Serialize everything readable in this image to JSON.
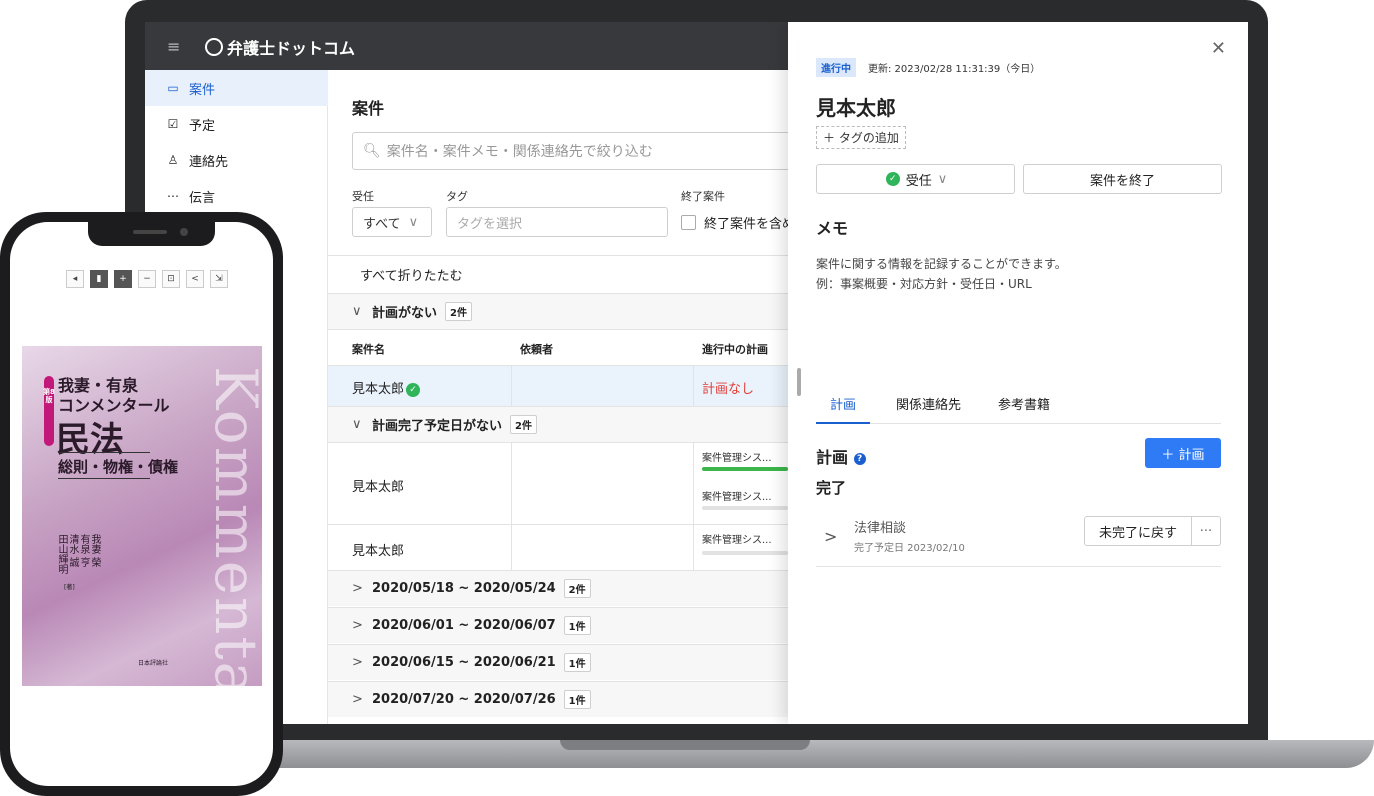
{
  "app": {
    "logo": "弁護士ドットコム",
    "menu_icon": "≡"
  },
  "sidebar": {
    "items": [
      {
        "label": "案件",
        "icon": "folder-icon",
        "glyph": "▭",
        "active": true
      },
      {
        "label": "予定",
        "icon": "checkbox-icon",
        "glyph": "☑",
        "active": false
      },
      {
        "label": "連絡先",
        "icon": "person-icon",
        "glyph": "♙",
        "active": false
      },
      {
        "label": "伝言",
        "icon": "message-icon",
        "glyph": "⋯",
        "active": false
      }
    ]
  },
  "main": {
    "title": "案件",
    "search_placeholder": "案件名・案件メモ・関係連絡先で絞り込む",
    "filters": {
      "assign_label": "受任",
      "assign_value": "すべて",
      "tag_label": "タグ",
      "tag_placeholder": "タグを選択",
      "closed_label": "終了案件",
      "closed_checkbox": "終了案件を含め"
    },
    "collapse_all": "すべて折りたたむ",
    "columns": [
      "案件名",
      "依頼者",
      "進行中の計画"
    ],
    "groups": [
      {
        "title": "計画がない",
        "count": "2件",
        "rows": [
          {
            "name": "見本太郎",
            "client": "",
            "plan": "計画なし"
          }
        ]
      },
      {
        "title": "計画完了予定日がない",
        "count": "2件",
        "rows": [
          {
            "name": "見本太郎",
            "client": "",
            "plans": [
              "案件管理シス...",
              "案件管理シス..."
            ]
          },
          {
            "name": "見本太郎",
            "client": "",
            "plans": [
              "案件管理シス..."
            ]
          }
        ]
      },
      {
        "title": "2020/05/18 ~ 2020/05/24",
        "count": "2件"
      },
      {
        "title": "2020/06/01 ~ 2020/06/07",
        "count": "1件"
      },
      {
        "title": "2020/06/15 ~ 2020/06/21",
        "count": "1件"
      },
      {
        "title": "2020/07/20 ~ 2020/07/26",
        "count": "1件"
      }
    ]
  },
  "detail": {
    "status": "進行中",
    "updated": "更新: 2023/02/28 11:31:39（今日）",
    "title": "見本太郎",
    "tag_add": "＋ タグの追加",
    "assign_button": "受任",
    "end_button": "案件を終了",
    "memo_title": "メモ",
    "memo_text": "案件に関する情報を記録することができます。\n例：事案概要・対応方針・受任日・URL",
    "tabs": [
      "計画",
      "関係連絡先",
      "参考書籍"
    ],
    "plan_title": "計画",
    "add_plan": "＋ 計画",
    "done_title": "完了",
    "plan_item": {
      "name": "法律相談",
      "due": "完了予定日 2023/02/10",
      "revert": "未完了に戻す",
      "more": "···"
    }
  },
  "phone": {
    "book": {
      "edition": "第8版",
      "line1": "我妻・有泉",
      "line2": "コンメンタール",
      "line3": "民法",
      "line4": "総則・物権・債権",
      "authors": "我妻 榮　有泉 亨　清水 誠　田山輝明",
      "author_role": "[著]",
      "publisher": "日本評論社",
      "spine_word": "Kommentar"
    }
  },
  "colors": {
    "accent": "#2f7af5",
    "danger": "#e0403a",
    "success": "#2fb45a",
    "topbar": "#38393c"
  }
}
